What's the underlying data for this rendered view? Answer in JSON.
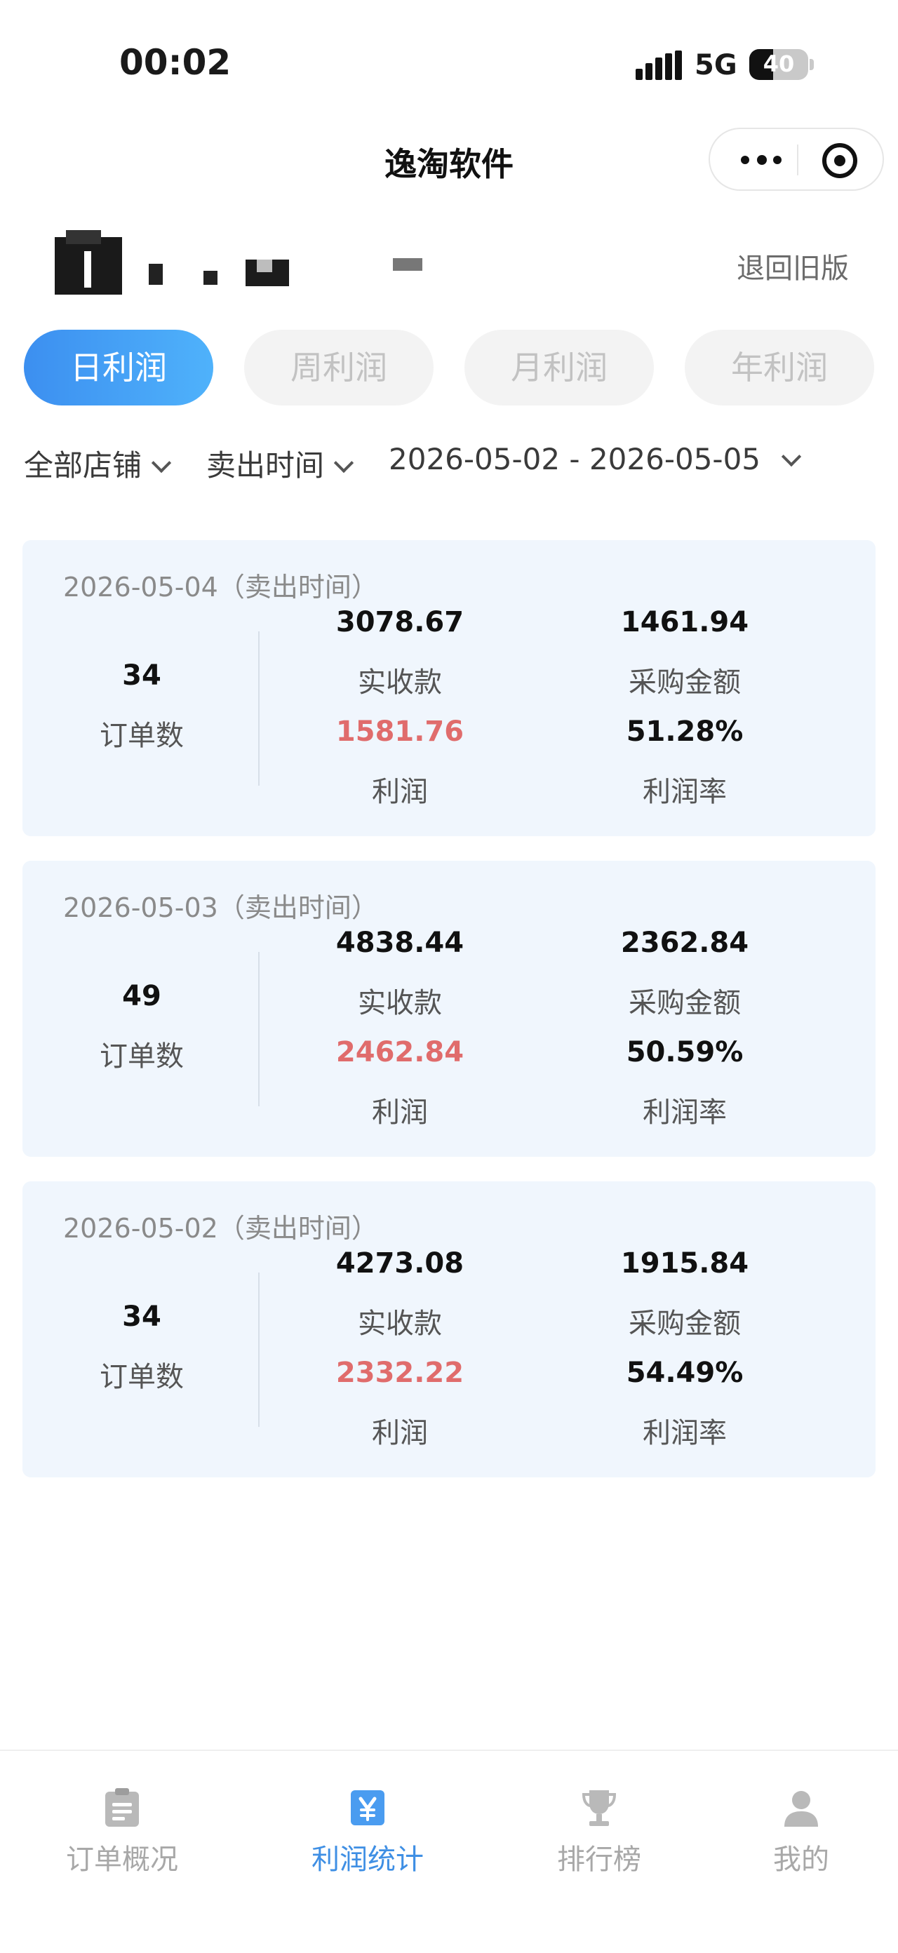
{
  "status_bar": {
    "time": "00:02",
    "network": "5G",
    "battery": "40",
    "battery_level": 0.4
  },
  "nav": {
    "title": "逸淘软件"
  },
  "header": {
    "old_version": "退回旧版"
  },
  "tabs": [
    {
      "label": "日利润",
      "active": true
    },
    {
      "label": "周利润",
      "active": false
    },
    {
      "label": "月利润",
      "active": false
    },
    {
      "label": "年利润",
      "active": false
    }
  ],
  "filters": {
    "shop": "全部店铺",
    "time_type": "卖出时间",
    "date_range": "2026-05-02 - 2026-05-05"
  },
  "cards": [
    {
      "date": "2026-05-04（卖出时间）",
      "orders": "34",
      "orders_label": "订单数",
      "revenue": "3078.67",
      "revenue_label": "实收款",
      "purchase": "1461.94",
      "purchase_label": "采购金额",
      "profit": "1581.76",
      "profit_label": "利润",
      "margin": "51.28%",
      "margin_label": "利润率"
    },
    {
      "date": "2026-05-03（卖出时间）",
      "orders": "49",
      "orders_label": "订单数",
      "revenue": "4838.44",
      "revenue_label": "实收款",
      "purchase": "2362.84",
      "purchase_label": "采购金额",
      "profit": "2462.84",
      "profit_label": "利润",
      "margin": "50.59%",
      "margin_label": "利润率"
    },
    {
      "date": "2026-05-02（卖出时间）",
      "orders": "34",
      "orders_label": "订单数",
      "revenue": "4273.08",
      "revenue_label": "实收款",
      "purchase": "1915.84",
      "purchase_label": "采购金额",
      "profit": "2332.22",
      "profit_label": "利润",
      "margin": "54.49%",
      "margin_label": "利润率"
    }
  ],
  "tabbar": [
    {
      "label": "订单概况",
      "icon": "clipboard-icon",
      "active": false
    },
    {
      "label": "利润统计",
      "icon": "yen-icon",
      "active": true
    },
    {
      "label": "排行榜",
      "icon": "trophy-icon",
      "active": false
    },
    {
      "label": "我的",
      "icon": "user-icon",
      "active": false
    }
  ],
  "colors": {
    "accent": "#3f8fe4",
    "profit": "#e06c6c",
    "card_bg": "#f0f6fd"
  }
}
